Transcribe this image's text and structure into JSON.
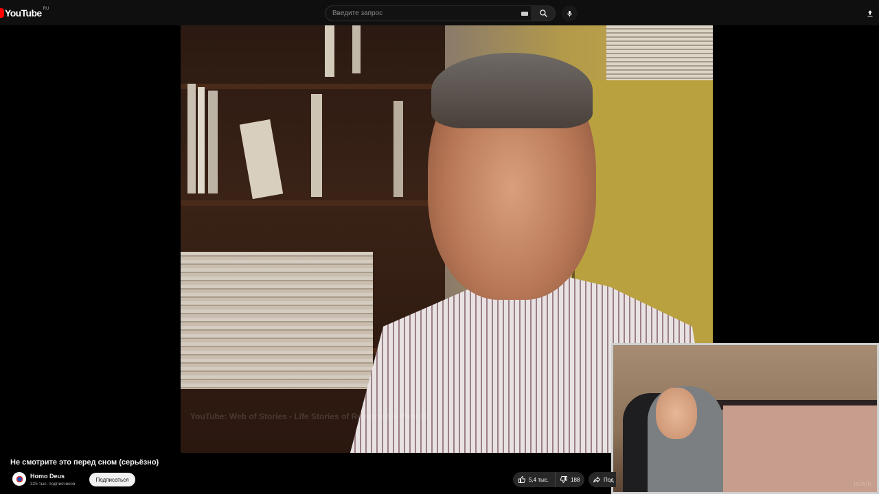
{
  "header": {
    "logo_text": "YouTube",
    "region": "RU",
    "search_placeholder": "Введите запрос",
    "icons": [
      "keyboard-icon",
      "search-icon",
      "mic-icon",
      "upload-icon"
    ]
  },
  "video": {
    "watermark": "YouTube: Web of Stories - Life Stories of Remarkable People",
    "title": "Не смотрите это перед сном (серьёзно)"
  },
  "webcam": {
    "watermark": "ncivin"
  },
  "channel": {
    "name": "Homo Deus",
    "subscribers": "325 тыс. подписчиков",
    "subscribe_label": "Подписаться"
  },
  "actions": {
    "likes": "5,4 тыс.",
    "dislikes": "188",
    "share_label": "Под"
  },
  "colors": {
    "brand_red": "#ff0000",
    "background": "#0f0f0f",
    "button_dark": "#272727"
  }
}
